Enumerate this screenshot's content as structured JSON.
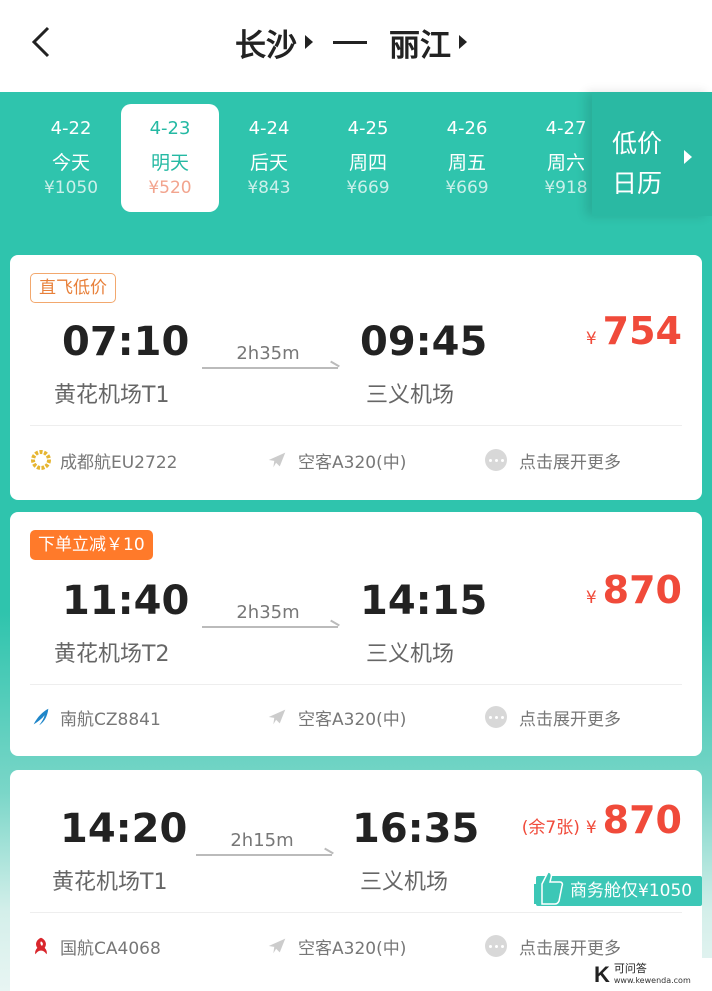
{
  "header": {
    "origin": "长沙",
    "destination": "丽江"
  },
  "dates": [
    {
      "date": "4-22",
      "day": "今天",
      "price": "¥1050",
      "active": false
    },
    {
      "date": "4-23",
      "day": "明天",
      "price": "¥520",
      "active": true
    },
    {
      "date": "4-24",
      "day": "后天",
      "price": "¥843",
      "active": false
    },
    {
      "date": "4-25",
      "day": "周四",
      "price": "¥669",
      "active": false
    },
    {
      "date": "4-26",
      "day": "周五",
      "price": "¥669",
      "active": false
    },
    {
      "date": "4-27",
      "day": "周六",
      "price": "¥918",
      "active": false
    }
  ],
  "low_calendar": {
    "label": "低价日历"
  },
  "flights": [
    {
      "badge": "直飞低价",
      "dep_time": "07:10",
      "dep_port": "黄花机场T1",
      "duration": "2h35m",
      "arr_time": "09:45",
      "arr_port": "三义机场",
      "currency": "¥",
      "price": "754",
      "airline": "成都航EU2722",
      "aircraft": "空客A320(中)",
      "more": "点击展开更多"
    },
    {
      "badge": "下单立减￥10",
      "dep_time": "11:40",
      "dep_port": "黄花机场T2",
      "duration": "2h35m",
      "arr_time": "14:15",
      "arr_port": "三义机场",
      "currency": "¥",
      "price": "870",
      "airline": "南航CZ8841",
      "aircraft": "空客A320(中)",
      "more": "点击展开更多"
    },
    {
      "remain": "(余7张)",
      "dep_time": "14:20",
      "dep_port": "黄花机场T1",
      "duration": "2h15m",
      "arr_time": "16:35",
      "arr_port": "三义机场",
      "currency": "¥",
      "price": "870",
      "business": "商务舱仅¥1050",
      "airline": "国航CA4068",
      "aircraft": "空客A320(中)",
      "more": "点击展开更多"
    }
  ],
  "watermark": {
    "letter": "K",
    "name": "可问答",
    "url": "www.kewenda.com"
  },
  "colors": {
    "teal": "#2fc4ad",
    "price_red": "#f04a3a",
    "badge_orange": "#ff7a2a"
  }
}
